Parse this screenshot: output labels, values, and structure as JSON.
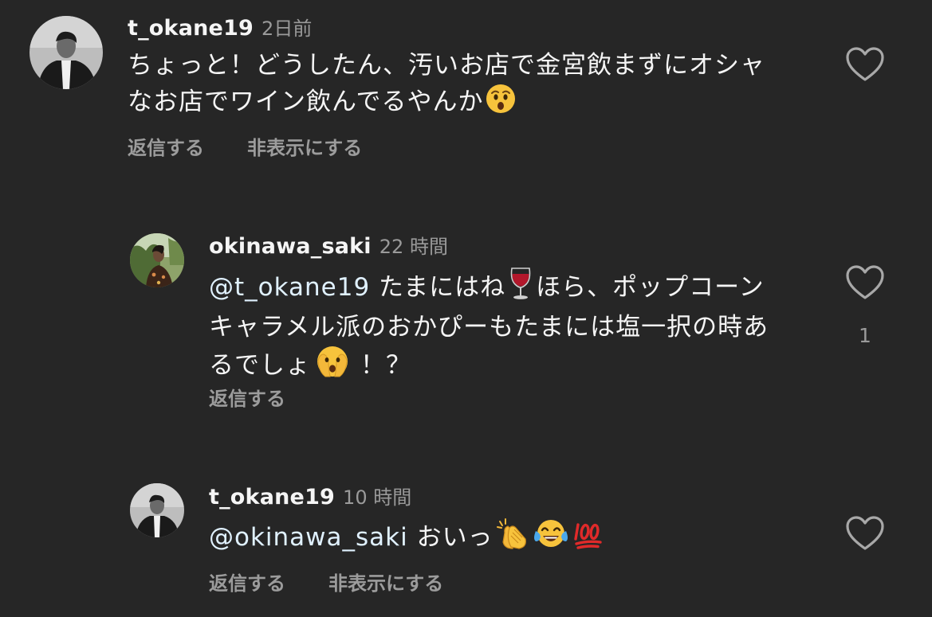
{
  "comments": [
    {
      "username": "t_okane19",
      "timestamp": "2日前",
      "line1": "ちょっと！どうしたん、汚いお店で金宮飲まずにオシャ",
      "line2": "なお店でワイン飲んでるやんか",
      "emoji": "hushed-face-icon",
      "reply_label": "返信する",
      "hide_label": "非表示にする",
      "like_count": ""
    },
    {
      "username": "okinawa_saki",
      "timestamp": "22 時間",
      "mention": "@t_okane19",
      "text_a": " たまにはね",
      "text_b": "ほら、ポップコーン",
      "line2": "キャラメル派のおかぴーもたまには塩一択の時あ",
      "line3": "るでしょ",
      "line3_tail": "！？",
      "reply_label": "返信する",
      "like_count": "1"
    },
    {
      "username": "t_okane19",
      "timestamp": "10 時間",
      "mention": "@okinawa_saki",
      "text": " おいっ",
      "reply_label": "返信する",
      "hide_label": "非表示にする",
      "like_count": ""
    }
  ],
  "colors": {
    "background": "#262626",
    "text": "#f5f5f5",
    "muted": "#9a9a9a",
    "mention": "#e0f1ff"
  }
}
